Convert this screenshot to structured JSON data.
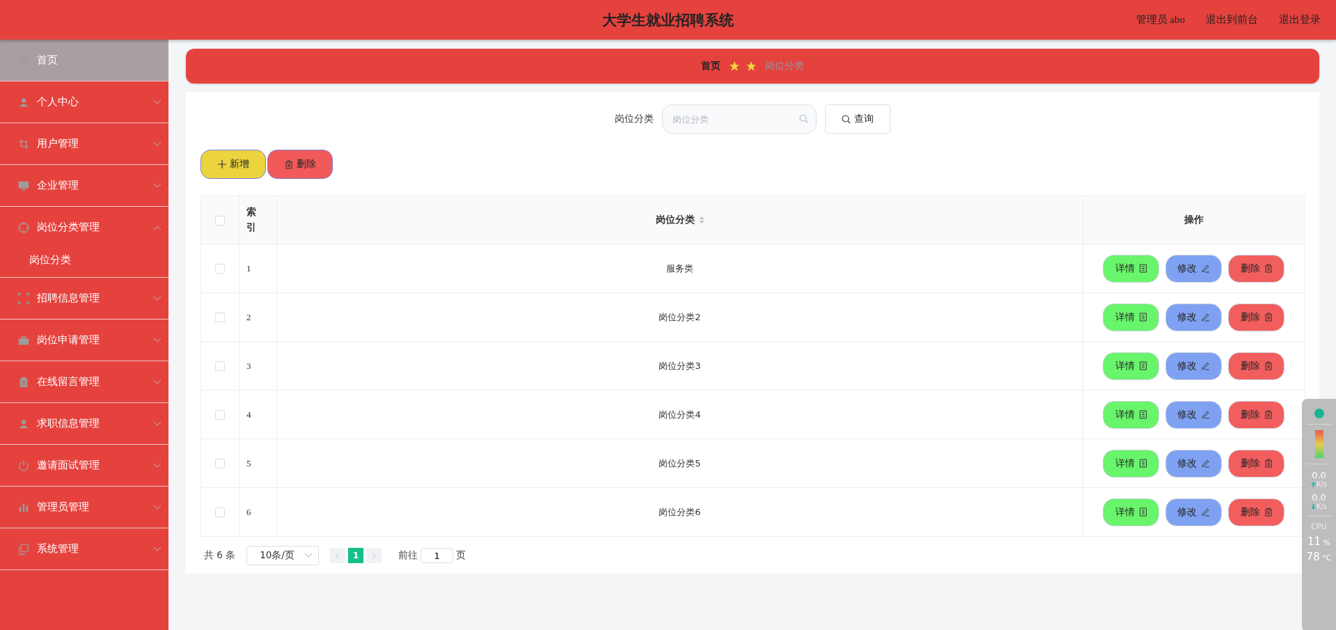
{
  "header": {
    "title": "大学生就业招聘系统",
    "links": [
      "管理员 abo",
      "退出到前台",
      "退出登录"
    ]
  },
  "sidebar": {
    "items": [
      {
        "label": "首页",
        "kind": "link",
        "selected": true
      },
      {
        "label": "个人中心",
        "kind": "menu",
        "selected": false,
        "expanded": false
      },
      {
        "label": "用户管理",
        "kind": "menu",
        "selected": false,
        "expanded": false
      },
      {
        "label": "企业管理",
        "kind": "menu",
        "selected": false,
        "expanded": false
      },
      {
        "label": "岗位分类管理",
        "kind": "menu",
        "selected": false,
        "expanded": true,
        "children": [
          {
            "label": "岗位分类",
            "selected": false
          }
        ]
      },
      {
        "label": "招聘信息管理",
        "kind": "menu",
        "selected": false,
        "expanded": false
      },
      {
        "label": "岗位申请管理",
        "kind": "menu",
        "selected": false,
        "expanded": false
      },
      {
        "label": "在线留言管理",
        "kind": "menu",
        "selected": false,
        "expanded": false
      },
      {
        "label": "求职信息管理",
        "kind": "menu",
        "selected": false,
        "expanded": false
      },
      {
        "label": "邀请面试管理",
        "kind": "menu",
        "selected": false,
        "expanded": false
      },
      {
        "label": "管理员管理",
        "kind": "menu",
        "selected": false,
        "expanded": false
      },
      {
        "label": "系统管理",
        "kind": "menu",
        "selected": false,
        "expanded": false
      }
    ]
  },
  "breadcrumb": [
    "首页",
    "岗位分类"
  ],
  "search": {
    "label": "岗位分类",
    "placeholder": "岗位分类",
    "button": "查询"
  },
  "toolbar": [
    {
      "label": "新增",
      "color": "#ebd43f"
    },
    {
      "label": "删除",
      "color": "#f25a5a"
    }
  ],
  "table": {
    "header_checked": false,
    "columns": [
      "索引",
      "岗位分类",
      "操作"
    ],
    "rows": [
      {
        "checked": false,
        "index": "1",
        "category": "服务类",
        "actions": [
          {
            "label": "详情",
            "color": "#68f56b"
          },
          {
            "label": "修改",
            "color": "#7fa1f2"
          },
          {
            "label": "删除",
            "color": "#f25e5e"
          }
        ]
      },
      {
        "checked": false,
        "index": "2",
        "category": "岗位分类2",
        "actions": [
          {
            "label": "详情",
            "color": "#68f56b"
          },
          {
            "label": "修改",
            "color": "#7fa1f2"
          },
          {
            "label": "删除",
            "color": "#f25e5e"
          }
        ]
      },
      {
        "checked": false,
        "index": "3",
        "category": "岗位分类3",
        "actions": [
          {
            "label": "详情",
            "color": "#68f56b"
          },
          {
            "label": "修改",
            "color": "#7fa1f2"
          },
          {
            "label": "删除",
            "color": "#f25e5e"
          }
        ]
      },
      {
        "checked": false,
        "index": "4",
        "category": "岗位分类4",
        "actions": [
          {
            "label": "详情",
            "color": "#68f56b"
          },
          {
            "label": "修改",
            "color": "#7fa1f2"
          },
          {
            "label": "删除",
            "color": "#f25e5e"
          }
        ]
      },
      {
        "checked": false,
        "index": "5",
        "category": "岗位分类5",
        "actions": [
          {
            "label": "详情",
            "color": "#68f56b"
          },
          {
            "label": "修改",
            "color": "#7fa1f2"
          },
          {
            "label": "删除",
            "color": "#f25e5e"
          }
        ]
      },
      {
        "checked": false,
        "index": "6",
        "category": "岗位分类6",
        "actions": [
          {
            "label": "详情",
            "color": "#68f56b"
          },
          {
            "label": "修改",
            "color": "#7fa1f2"
          },
          {
            "label": "删除",
            "color": "#f25e5e"
          }
        ]
      }
    ]
  },
  "pagination": {
    "total": "共 6 条",
    "page_size": "10条/页",
    "pages": [
      {
        "label": "1",
        "selected": true
      }
    ],
    "goto_label": "前往",
    "goto_value": "1",
    "page_suffix": "页"
  },
  "monitor": {
    "upload": "0.0",
    "upload_unit": "K/s",
    "download": "0.0",
    "download_unit": "K/s",
    "cpu_label": "CPU",
    "cpu": "11",
    "cpu_unit": "%",
    "temperature": "78",
    "temperature_unit": "°C"
  }
}
